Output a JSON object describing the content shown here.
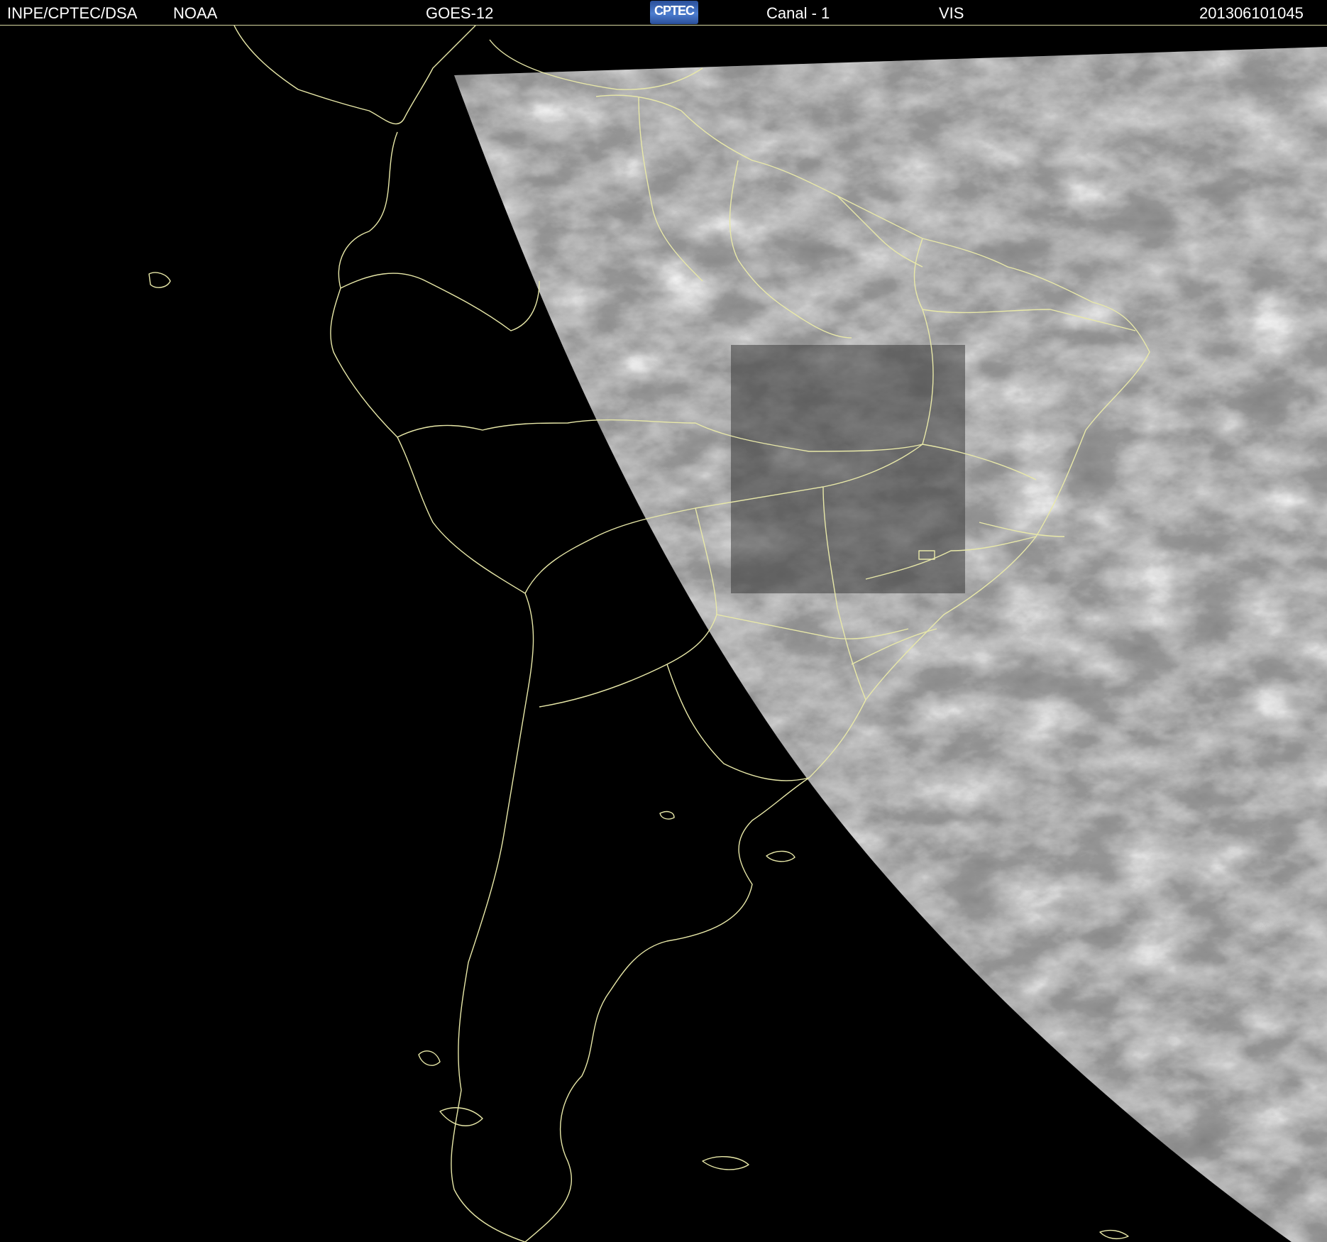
{
  "header": {
    "institution": "INPE/CPTEC/DSA",
    "agency": "NOAA",
    "satellite": "GOES-12",
    "logo_text": "CPTEC",
    "channel": "Canal - 1",
    "band": "VIS",
    "timestamp": "201306101045"
  },
  "map": {
    "region": "South America",
    "imagery": "visible satellite image with cloud cover",
    "boundary_color": "#e8e8a8",
    "background_color": "#000000"
  }
}
